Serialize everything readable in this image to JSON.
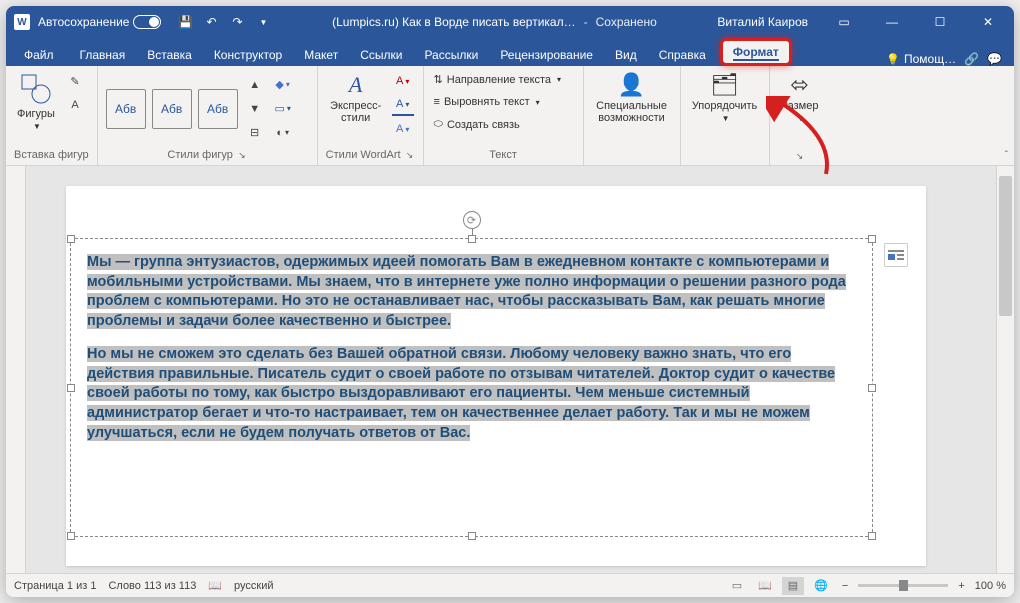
{
  "titlebar": {
    "autosave": "Автосохранение",
    "doc_title": "(Lumpics.ru) Как в Ворде писать вертикал…",
    "saved": "Сохранено",
    "user": "Виталий Каиров"
  },
  "tabs": {
    "file": "Файл",
    "home": "Главная",
    "insert": "Вставка",
    "design": "Конструктор",
    "layout": "Макет",
    "references": "Ссылки",
    "mailings": "Рассылки",
    "review": "Рецензирование",
    "view": "Вид",
    "help": "Справка",
    "format": "Формат",
    "tellme": "Помощ…"
  },
  "ribbon": {
    "insert_shapes": {
      "shapes": "Фигуры",
      "group": "Вставка фигур"
    },
    "shape_styles": {
      "abv": "Абв",
      "group": "Стили фигур"
    },
    "wordart": {
      "express": "Экспресс-стили",
      "group": "Стили WordArt"
    },
    "text": {
      "direction": "Направление текста",
      "align": "Выровнять текст",
      "link": "Создать связь",
      "group": "Текст"
    },
    "accessibility": {
      "label": "Специальные\nвозможности"
    },
    "arrange": {
      "label": "Упорядочить"
    },
    "size": {
      "label": "Размер"
    }
  },
  "document": {
    "p1": "Мы — группа энтузиастов, одержимых идеей помогать Вам в ежедневном контакте с компьютерами и мобильными устройствами. Мы знаем, что в интернете уже полно информации о решении разного рода проблем с компьютерами. Но это не останавливает нас, чтобы рассказывать Вам, как решать многие проблемы и задачи более качественно и быстрее.",
    "p2": "Но мы не сможем это сделать без Вашей обратной связи. Любому человеку важно знать, что его действия правильные. Писатель судит о своей работе по отзывам читателей. Доктор судит о качестве своей работы по тому, как быстро выздоравливают его пациенты. Чем меньше системный администратор бегает и что-то настраивает, тем он качественнее делает работу. Так и мы не можем улучшаться, если не будем получать ответов от Вас."
  },
  "status": {
    "page": "Страница 1 из 1",
    "words": "Слово 113 из 113",
    "lang": "русский",
    "zoom": "100 %"
  }
}
